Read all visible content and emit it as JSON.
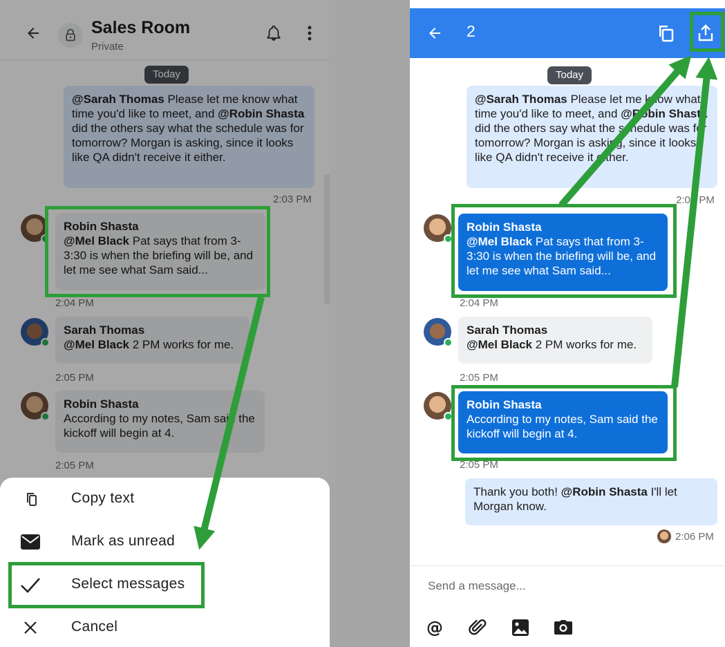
{
  "left": {
    "header": {
      "title": "Sales Room",
      "subtitle": "Private"
    },
    "date_label": "Today",
    "messages": [
      {
        "segments": [
          "@Sarah Thomas",
          " Please let me know what time you'd like to meet, and ",
          "@Robin Shasta",
          " did the others say what the schedule was for tomorrow? Morgan is asking, since it looks like QA didn't receive it either."
        ],
        "time": "2:03 PM"
      },
      {
        "sender": "Robin Shasta",
        "segments": [
          "@Mel Black",
          " Pat says that from 3-3:30 is when the briefing will be, and let me see what Sam said..."
        ],
        "time": "2:04 PM"
      },
      {
        "sender": "Sarah Thomas",
        "segments": [
          "@Mel Black",
          " 2 PM works for me."
        ],
        "time": "2:05 PM"
      },
      {
        "sender": "Robin Shasta",
        "text": "According to my notes, Sam said the kickoff will begin at 4.",
        "time": "2:05 PM"
      }
    ],
    "action_sheet": [
      {
        "label": "Copy text",
        "icon": "copy-icon"
      },
      {
        "label": "Mark as unread",
        "icon": "envelope-icon"
      },
      {
        "label": "Select messages",
        "icon": "checkmark-icon"
      },
      {
        "label": "Cancel",
        "icon": "close-icon"
      }
    ]
  },
  "right": {
    "header": {
      "count": "2"
    },
    "date_label": "Today",
    "messages": [
      {
        "segments": [
          "@Sarah Thomas",
          " Please let me know what time you'd like to meet, and ",
          "@Robin Shasta",
          " did the others say what the schedule was for tomorrow? Morgan is asking, since it looks like QA didn't receive it either."
        ],
        "time": "2:03 PM"
      },
      {
        "sender": "Robin Shasta",
        "segments": [
          "@Mel Black",
          " Pat says that from 3-3:30 is when the briefing will be, and let me see what Sam said..."
        ],
        "time": "2:04 PM",
        "selected": true
      },
      {
        "sender": "Sarah Thomas",
        "segments": [
          "@Mel Black",
          " 2 PM works for me."
        ],
        "time": "2:05 PM"
      },
      {
        "sender": "Robin Shasta",
        "text": "According to my notes, Sam said the kickoff will begin at 4.",
        "time": "2:05 PM",
        "selected": true
      },
      {
        "segments": [
          "Thank you both! ",
          "@Robin Shasta",
          " I'll let Morgan know."
        ],
        "time": "2:06 PM"
      }
    ],
    "composer": {
      "placeholder": "Send a message..."
    }
  },
  "colors": {
    "brand_blue": "#2f80ed",
    "selected_bubble": "#0f6fd9",
    "highlight_green": "#2e9e3a",
    "online": "#2bb05a"
  }
}
